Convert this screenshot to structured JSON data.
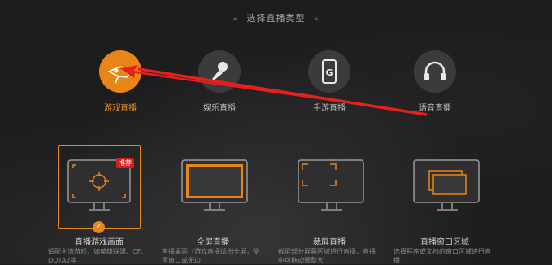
{
  "header": {
    "title": "选择直播类型",
    "deco_left": "«",
    "deco_right": "»"
  },
  "stream_types": [
    {
      "label": "游戏直播",
      "icon": "gamepad-icon",
      "active": true
    },
    {
      "label": "娱乐直播",
      "icon": "microphone-icon",
      "active": false
    },
    {
      "label": "手游直播",
      "icon": "phone-icon",
      "active": false
    },
    {
      "label": "语音直播",
      "icon": "headphones-icon",
      "active": false
    }
  ],
  "capture_modes": [
    {
      "label": "直播游戏画面",
      "desc": "适配主流游戏，如英雄联盟、CF、DOTA2等",
      "badge": "推荐",
      "active": true
    },
    {
      "label": "全屏直播",
      "desc": "直播桌面（游戏直播适出全屏，使用窗口或无边",
      "active": false
    },
    {
      "label": "裁屏直播",
      "desc": "截屏部分屏幕区域进行直播，直播中可拖动调整大",
      "active": false
    },
    {
      "label": "直播窗口区域",
      "desc": "选择程序或文档的窗口区域进行直播",
      "active": false
    }
  ],
  "colors": {
    "accent": "#e88517",
    "badge": "#d01f1f",
    "annotation_arrow": "#e8201c"
  }
}
